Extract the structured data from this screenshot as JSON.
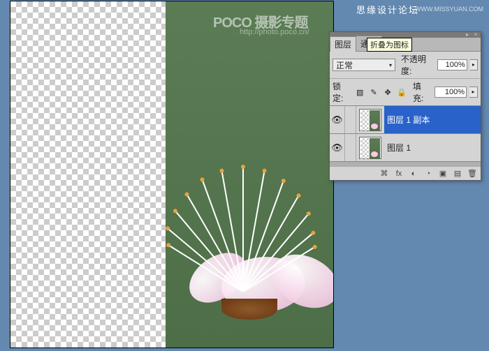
{
  "watermark": {
    "poco": "POCO 摄影专题",
    "poco_url": "http://photo.poco.cn/",
    "siyuan": "思缘设计论坛",
    "missyuan": "WWW.MISSYUAN.COM"
  },
  "panel": {
    "tabs": {
      "layers": "图层",
      "channels": "通道"
    },
    "tooltip": "折叠为图标",
    "blend_mode": "正常",
    "opacity_label": "不透明度:",
    "opacity_value": "100%",
    "lock_label": "锁定:",
    "fill_label": "填充:",
    "fill_value": "100%",
    "lock_icons": {
      "pixel": "▧",
      "brush": "✎",
      "move": "✥",
      "all": "🔒"
    },
    "layers": [
      {
        "name": "图层 1 副本",
        "selected": true
      },
      {
        "name": "图层 1",
        "selected": false
      }
    ],
    "footer_icons": {
      "link": "⌘",
      "fx": "fx",
      "mask": "◐",
      "adjust": "◔",
      "group": "▣",
      "new": "▤",
      "trash": "🗑"
    },
    "titlebar": {
      "menu": "▸",
      "close": "×"
    }
  }
}
